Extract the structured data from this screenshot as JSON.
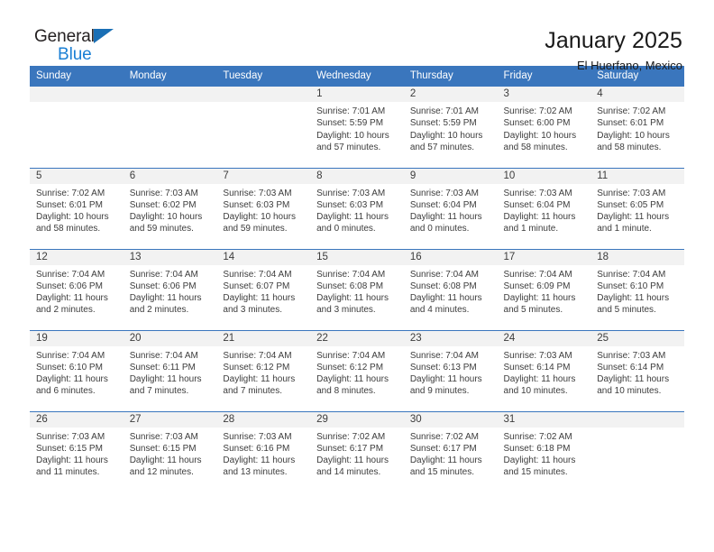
{
  "logo": {
    "word1": "General",
    "word2": "Blue",
    "triangle_icon": "triangle-icon",
    "blue": "#1a7fd4"
  },
  "header": {
    "title": "January 2025",
    "location": "El Huerfano, Mexico"
  },
  "theme": {
    "header_blue": "#3a76bd",
    "daynum_bg": "#f2f2f2",
    "text": "#3c3c3c"
  },
  "weekday_headers": [
    "Sunday",
    "Monday",
    "Tuesday",
    "Wednesday",
    "Thursday",
    "Friday",
    "Saturday"
  ],
  "labels": {
    "sunrise": "Sunrise:",
    "sunset": "Sunset:",
    "daylight": "Daylight:"
  },
  "weeks": [
    [
      {
        "day": "",
        "empty": true
      },
      {
        "day": "",
        "empty": true
      },
      {
        "day": "",
        "empty": true
      },
      {
        "day": "1",
        "sunrise": "Sunrise: 7:01 AM",
        "sunset": "Sunset: 5:59 PM",
        "daylight_l1": "Daylight: 10 hours",
        "daylight_l2": "and 57 minutes."
      },
      {
        "day": "2",
        "sunrise": "Sunrise: 7:01 AM",
        "sunset": "Sunset: 5:59 PM",
        "daylight_l1": "Daylight: 10 hours",
        "daylight_l2": "and 57 minutes."
      },
      {
        "day": "3",
        "sunrise": "Sunrise: 7:02 AM",
        "sunset": "Sunset: 6:00 PM",
        "daylight_l1": "Daylight: 10 hours",
        "daylight_l2": "and 58 minutes."
      },
      {
        "day": "4",
        "sunrise": "Sunrise: 7:02 AM",
        "sunset": "Sunset: 6:01 PM",
        "daylight_l1": "Daylight: 10 hours",
        "daylight_l2": "and 58 minutes."
      }
    ],
    [
      {
        "day": "5",
        "sunrise": "Sunrise: 7:02 AM",
        "sunset": "Sunset: 6:01 PM",
        "daylight_l1": "Daylight: 10 hours",
        "daylight_l2": "and 58 minutes."
      },
      {
        "day": "6",
        "sunrise": "Sunrise: 7:03 AM",
        "sunset": "Sunset: 6:02 PM",
        "daylight_l1": "Daylight: 10 hours",
        "daylight_l2": "and 59 minutes."
      },
      {
        "day": "7",
        "sunrise": "Sunrise: 7:03 AM",
        "sunset": "Sunset: 6:03 PM",
        "daylight_l1": "Daylight: 10 hours",
        "daylight_l2": "and 59 minutes."
      },
      {
        "day": "8",
        "sunrise": "Sunrise: 7:03 AM",
        "sunset": "Sunset: 6:03 PM",
        "daylight_l1": "Daylight: 11 hours",
        "daylight_l2": "and 0 minutes."
      },
      {
        "day": "9",
        "sunrise": "Sunrise: 7:03 AM",
        "sunset": "Sunset: 6:04 PM",
        "daylight_l1": "Daylight: 11 hours",
        "daylight_l2": "and 0 minutes."
      },
      {
        "day": "10",
        "sunrise": "Sunrise: 7:03 AM",
        "sunset": "Sunset: 6:04 PM",
        "daylight_l1": "Daylight: 11 hours",
        "daylight_l2": "and 1 minute."
      },
      {
        "day": "11",
        "sunrise": "Sunrise: 7:03 AM",
        "sunset": "Sunset: 6:05 PM",
        "daylight_l1": "Daylight: 11 hours",
        "daylight_l2": "and 1 minute."
      }
    ],
    [
      {
        "day": "12",
        "sunrise": "Sunrise: 7:04 AM",
        "sunset": "Sunset: 6:06 PM",
        "daylight_l1": "Daylight: 11 hours",
        "daylight_l2": "and 2 minutes."
      },
      {
        "day": "13",
        "sunrise": "Sunrise: 7:04 AM",
        "sunset": "Sunset: 6:06 PM",
        "daylight_l1": "Daylight: 11 hours",
        "daylight_l2": "and 2 minutes."
      },
      {
        "day": "14",
        "sunrise": "Sunrise: 7:04 AM",
        "sunset": "Sunset: 6:07 PM",
        "daylight_l1": "Daylight: 11 hours",
        "daylight_l2": "and 3 minutes."
      },
      {
        "day": "15",
        "sunrise": "Sunrise: 7:04 AM",
        "sunset": "Sunset: 6:08 PM",
        "daylight_l1": "Daylight: 11 hours",
        "daylight_l2": "and 3 minutes."
      },
      {
        "day": "16",
        "sunrise": "Sunrise: 7:04 AM",
        "sunset": "Sunset: 6:08 PM",
        "daylight_l1": "Daylight: 11 hours",
        "daylight_l2": "and 4 minutes."
      },
      {
        "day": "17",
        "sunrise": "Sunrise: 7:04 AM",
        "sunset": "Sunset: 6:09 PM",
        "daylight_l1": "Daylight: 11 hours",
        "daylight_l2": "and 5 minutes."
      },
      {
        "day": "18",
        "sunrise": "Sunrise: 7:04 AM",
        "sunset": "Sunset: 6:10 PM",
        "daylight_l1": "Daylight: 11 hours",
        "daylight_l2": "and 5 minutes."
      }
    ],
    [
      {
        "day": "19",
        "sunrise": "Sunrise: 7:04 AM",
        "sunset": "Sunset: 6:10 PM",
        "daylight_l1": "Daylight: 11 hours",
        "daylight_l2": "and 6 minutes."
      },
      {
        "day": "20",
        "sunrise": "Sunrise: 7:04 AM",
        "sunset": "Sunset: 6:11 PM",
        "daylight_l1": "Daylight: 11 hours",
        "daylight_l2": "and 7 minutes."
      },
      {
        "day": "21",
        "sunrise": "Sunrise: 7:04 AM",
        "sunset": "Sunset: 6:12 PM",
        "daylight_l1": "Daylight: 11 hours",
        "daylight_l2": "and 7 minutes."
      },
      {
        "day": "22",
        "sunrise": "Sunrise: 7:04 AM",
        "sunset": "Sunset: 6:12 PM",
        "daylight_l1": "Daylight: 11 hours",
        "daylight_l2": "and 8 minutes."
      },
      {
        "day": "23",
        "sunrise": "Sunrise: 7:04 AM",
        "sunset": "Sunset: 6:13 PM",
        "daylight_l1": "Daylight: 11 hours",
        "daylight_l2": "and 9 minutes."
      },
      {
        "day": "24",
        "sunrise": "Sunrise: 7:03 AM",
        "sunset": "Sunset: 6:14 PM",
        "daylight_l1": "Daylight: 11 hours",
        "daylight_l2": "and 10 minutes."
      },
      {
        "day": "25",
        "sunrise": "Sunrise: 7:03 AM",
        "sunset": "Sunset: 6:14 PM",
        "daylight_l1": "Daylight: 11 hours",
        "daylight_l2": "and 10 minutes."
      }
    ],
    [
      {
        "day": "26",
        "sunrise": "Sunrise: 7:03 AM",
        "sunset": "Sunset: 6:15 PM",
        "daylight_l1": "Daylight: 11 hours",
        "daylight_l2": "and 11 minutes."
      },
      {
        "day": "27",
        "sunrise": "Sunrise: 7:03 AM",
        "sunset": "Sunset: 6:15 PM",
        "daylight_l1": "Daylight: 11 hours",
        "daylight_l2": "and 12 minutes."
      },
      {
        "day": "28",
        "sunrise": "Sunrise: 7:03 AM",
        "sunset": "Sunset: 6:16 PM",
        "daylight_l1": "Daylight: 11 hours",
        "daylight_l2": "and 13 minutes."
      },
      {
        "day": "29",
        "sunrise": "Sunrise: 7:02 AM",
        "sunset": "Sunset: 6:17 PM",
        "daylight_l1": "Daylight: 11 hours",
        "daylight_l2": "and 14 minutes."
      },
      {
        "day": "30",
        "sunrise": "Sunrise: 7:02 AM",
        "sunset": "Sunset: 6:17 PM",
        "daylight_l1": "Daylight: 11 hours",
        "daylight_l2": "and 15 minutes."
      },
      {
        "day": "31",
        "sunrise": "Sunrise: 7:02 AM",
        "sunset": "Sunset: 6:18 PM",
        "daylight_l1": "Daylight: 11 hours",
        "daylight_l2": "and 15 minutes."
      },
      {
        "day": "",
        "empty": true
      }
    ]
  ]
}
